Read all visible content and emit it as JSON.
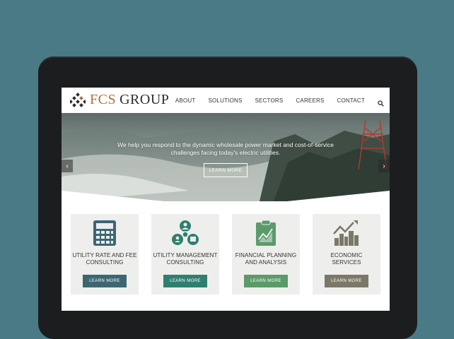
{
  "brand": {
    "name_accent": "FCS",
    "name_rest": "GROUP"
  },
  "nav": {
    "items": [
      "ABOUT",
      "SOLUTIONS",
      "SECTORS",
      "CAREERS",
      "CONTACT"
    ]
  },
  "hero": {
    "line1": "We help you respond to the dynamic wholesale power market and cost-of-service",
    "line2": "challenges facing today's electric utilities.",
    "button": "LEARN MORE",
    "prev": "‹",
    "next": "›"
  },
  "cards": [
    {
      "title1": "UTILITY RATE AND FEE",
      "title2": "CONSULTING",
      "button": "LEARN MORE",
      "color": "#3d6673",
      "icon": "calculator-icon"
    },
    {
      "title1": "UTILITY MANAGEMENT",
      "title2": "CONSULTING",
      "button": "LEARN MORE",
      "color": "#2f7f71",
      "icon": "team-network-icon"
    },
    {
      "title1": "FINANCIAL PLANNING",
      "title2": "AND ANALYSIS",
      "button": "LEARN MORE",
      "color": "#5c9a6a",
      "icon": "clipboard-chart-icon"
    },
    {
      "title1": "ECONOMIC",
      "title2": "SERVICES",
      "button": "LEARN MORE",
      "color": "#7b7868",
      "icon": "growth-city-icon"
    }
  ],
  "colors": {
    "background": "#4a7a86",
    "tablet": "#1b1d1f",
    "accent": "#b0703a"
  }
}
